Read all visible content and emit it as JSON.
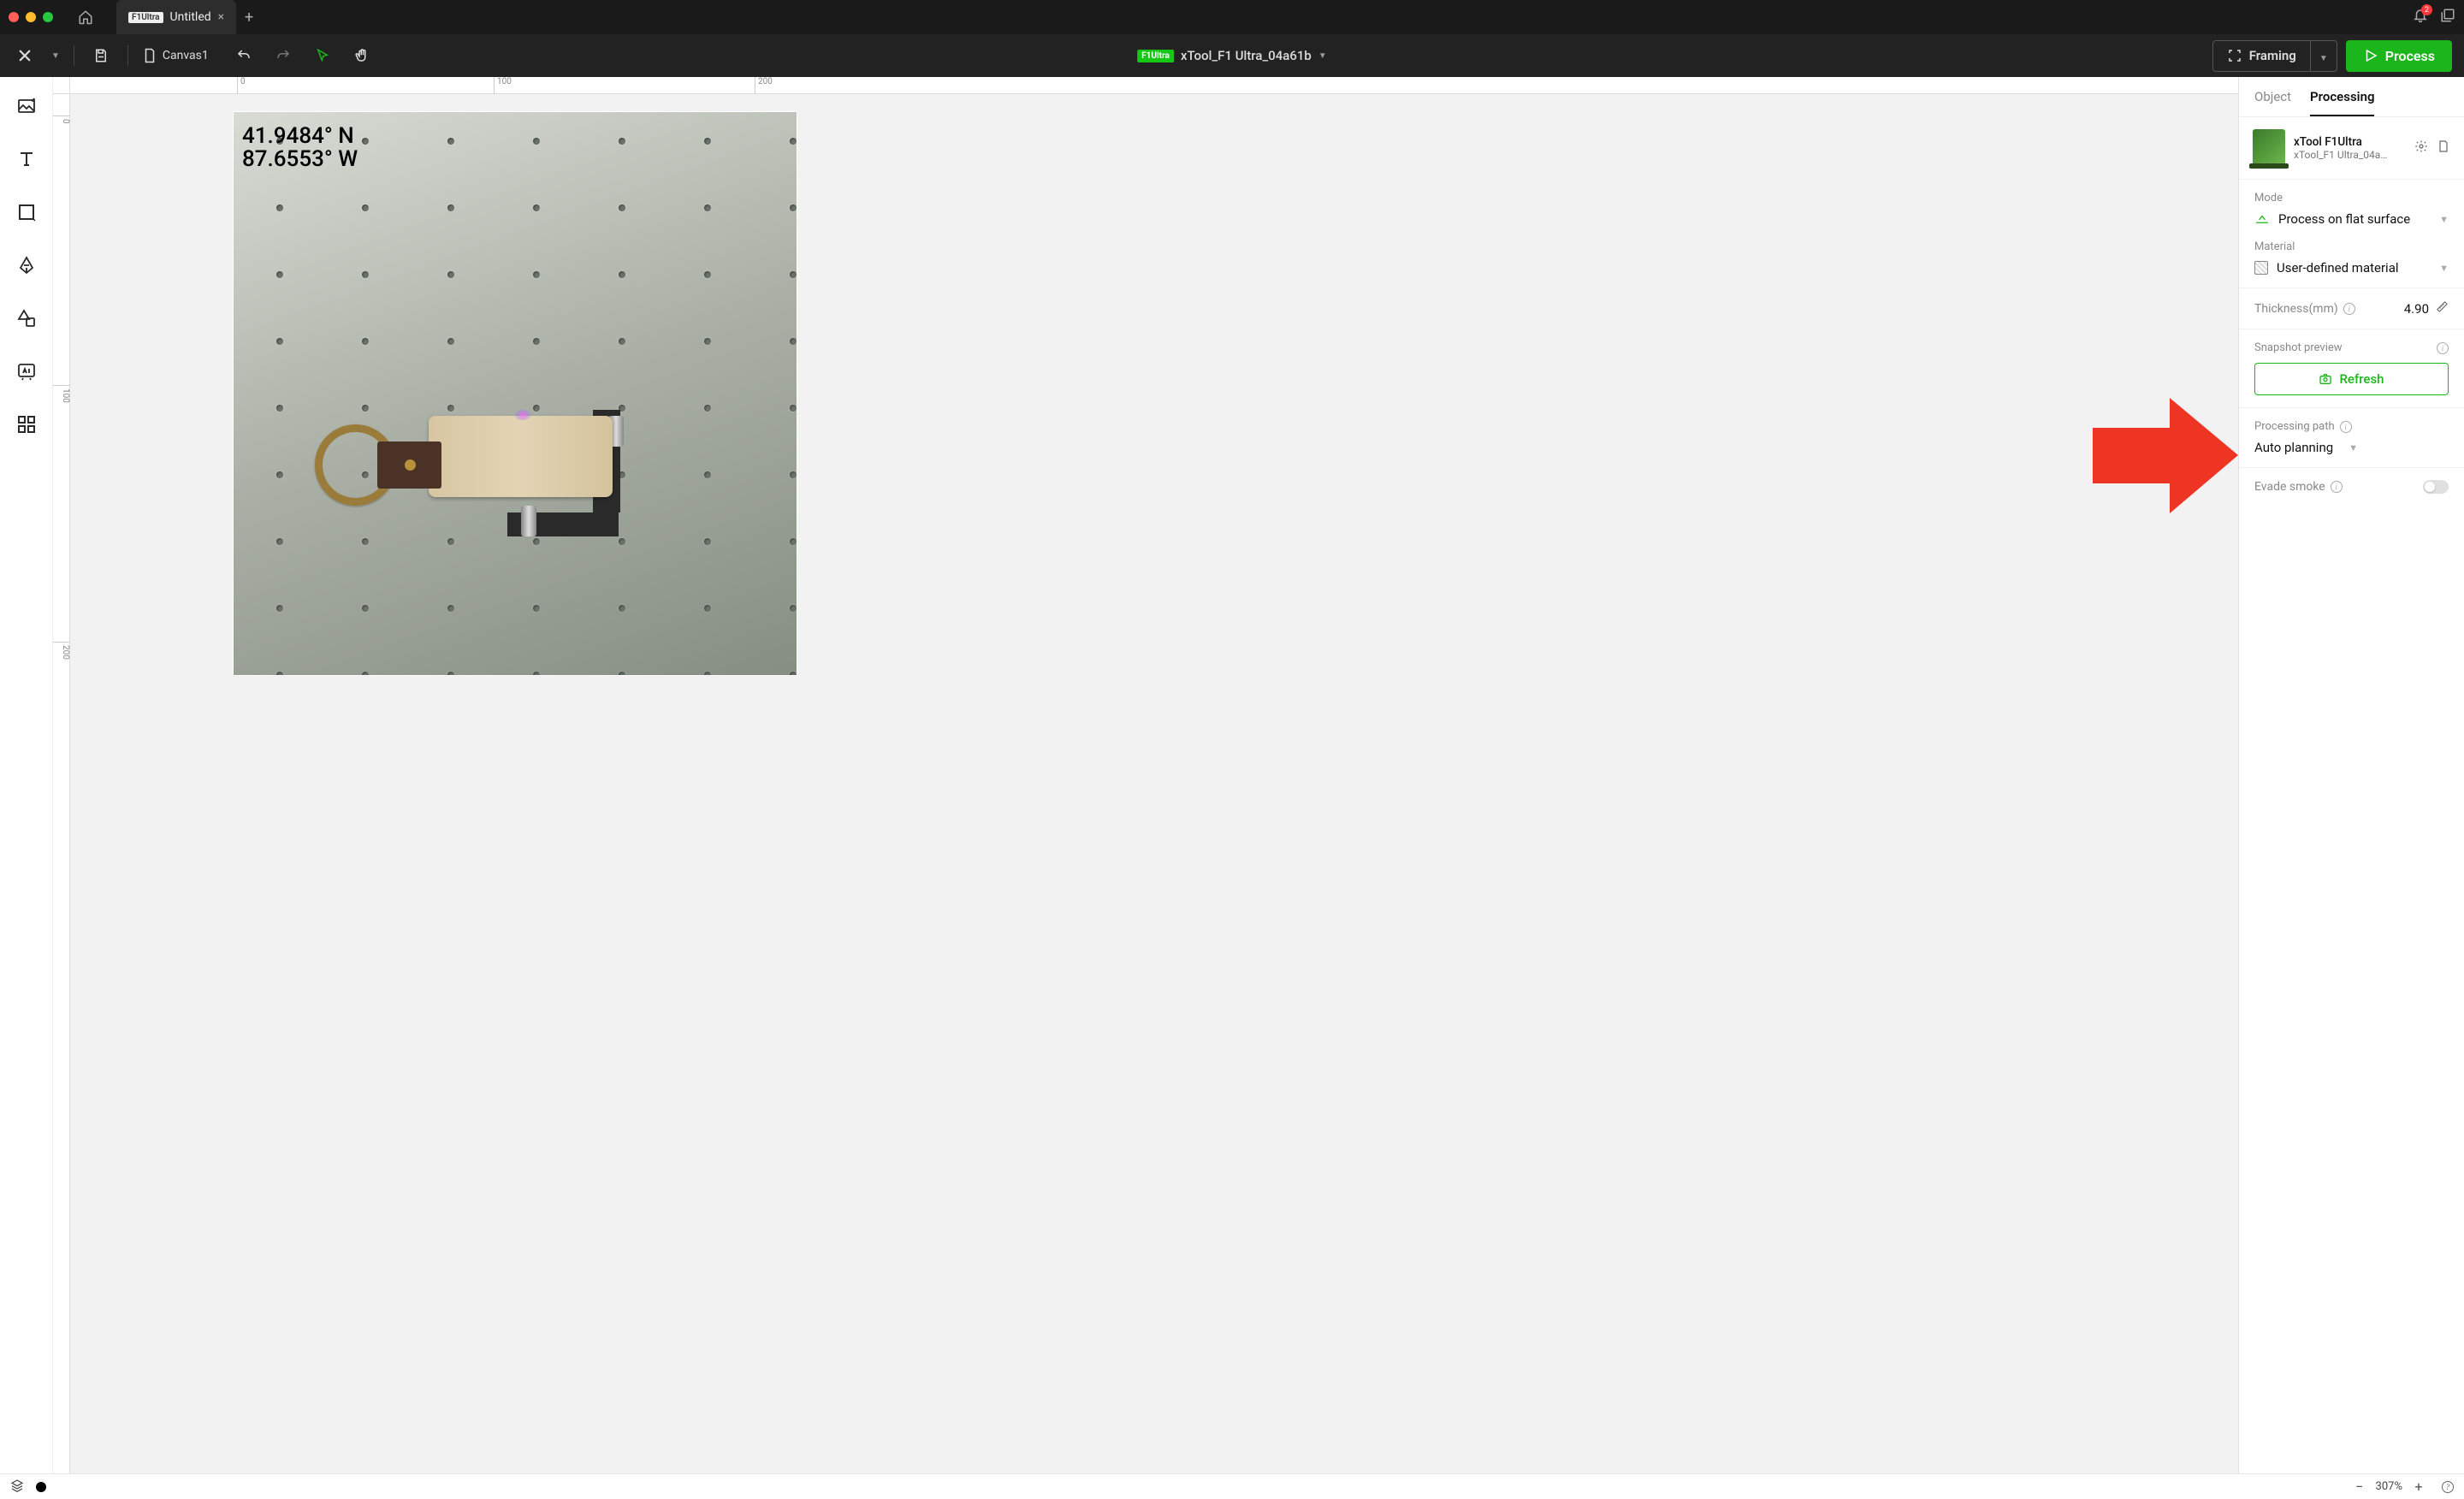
{
  "titlebar": {
    "tab_badge": "F1Ultra",
    "tab_title": "Untitled",
    "notification_count": "2"
  },
  "toolbar": {
    "canvas_tab": "Canvas1",
    "device_badge": "F1Ultra",
    "device_name": "xTool_F1 Ultra_04a61b",
    "framing_label": "Framing",
    "process_label": "Process"
  },
  "rulers": {
    "h": [
      "0",
      "100",
      "200"
    ],
    "v": [
      "0",
      "100",
      "200"
    ]
  },
  "canvas": {
    "coord_lat": "41.9484° N",
    "coord_lon": "87.6553° W"
  },
  "right_panel": {
    "tab_object": "Object",
    "tab_processing": "Processing",
    "device_name": "xTool F1Ultra",
    "device_code": "xTool_F1 Ultra_04a…",
    "mode_label": "Mode",
    "mode_value": "Process on flat surface",
    "material_label": "Material",
    "material_value": "User-defined material",
    "thickness_label": "Thickness(mm)",
    "thickness_value": "4.90",
    "snapshot_label": "Snapshot preview",
    "refresh_label": "Refresh",
    "path_label": "Processing path",
    "path_value": "Auto planning",
    "evade_label": "Evade smoke"
  },
  "statusbar": {
    "zoom": "307%"
  }
}
